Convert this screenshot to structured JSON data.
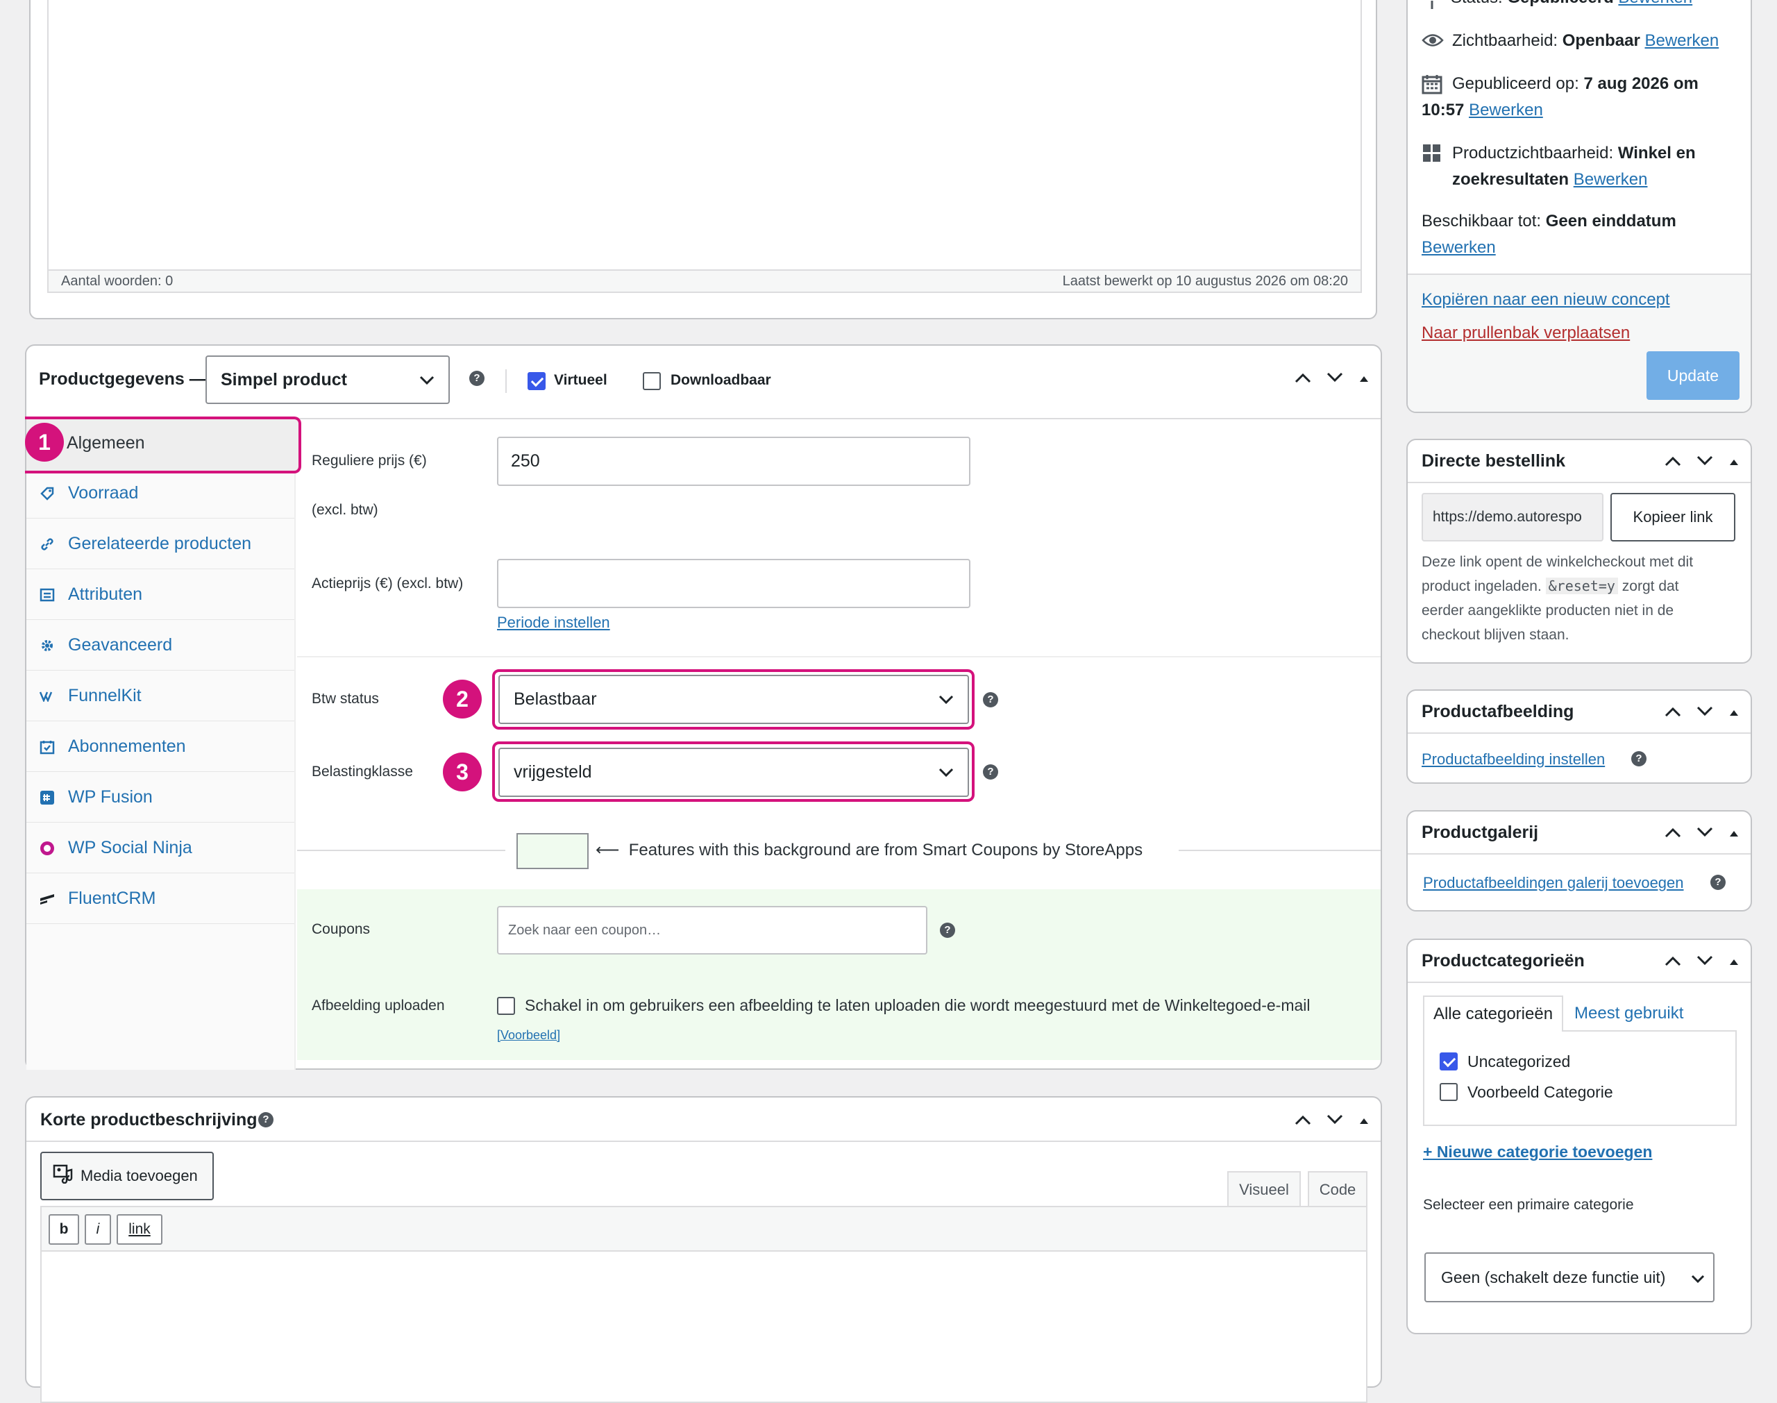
{
  "editor": {
    "word_count": "Aantal woorden: 0",
    "last_edited": "Laatst bewerkt op 10 augustus 2026 om 08:20"
  },
  "product_data": {
    "title": "Productgegevens —",
    "type_select": "Simpel product",
    "virtual_label": "Virtueel",
    "virtual_checked": true,
    "downloadable_label": "Downloadbaar",
    "downloadable_checked": false,
    "tabs": [
      {
        "label": "Algemeen",
        "icon": "wrench-icon"
      },
      {
        "label": "Voorraad",
        "icon": "tag-icon"
      },
      {
        "label": "Gerelateerde producten",
        "icon": "link-icon"
      },
      {
        "label": "Attributen",
        "icon": "list-icon"
      },
      {
        "label": "Geavanceerd",
        "icon": "gear-icon"
      },
      {
        "label": "FunnelKit",
        "icon": "funnelkit-icon"
      },
      {
        "label": "Abonnementen",
        "icon": "calendar-check-icon"
      },
      {
        "label": "WP Fusion",
        "icon": "wpfusion-icon"
      },
      {
        "label": "WP Social Ninja",
        "icon": "social-ninja-icon"
      },
      {
        "label": "FluentCRM",
        "icon": "fluentcrm-icon"
      }
    ],
    "regular_price_label": "Reguliere prijs (€)",
    "regular_price_sub": "(excl. btw)",
    "regular_price_value": "250",
    "sale_price_label": "Actieprijs (€) (excl. btw)",
    "sale_price_value": "",
    "schedule_link": "Periode instellen",
    "tax_status_label": "Btw status",
    "tax_status_value": "Belastbaar",
    "tax_class_label": "Belastingklasse",
    "tax_class_value": "vrijgesteld",
    "smart_coupons_note": "⟵  Features with this background are from Smart Coupons by StoreApps",
    "coupons_label": "Coupons",
    "coupons_placeholder": "Zoek naar een coupon…",
    "upload_label": "Afbeelding uploaden",
    "upload_text": "Schakel in om gebruikers een afbeelding te laten uploaden die wordt meegestuurd met de Winkeltegoed-e-mail",
    "upload_example": "[Voorbeeld]",
    "badges": [
      "1",
      "2",
      "3"
    ],
    "highlight_color": "#d4127c"
  },
  "short_desc": {
    "title": "Korte productbeschrijving",
    "media_button": "Media toevoegen",
    "tab_visual": "Visueel",
    "tab_code": "Code",
    "qt_bold": "b",
    "qt_italic": "i",
    "qt_link": "link"
  },
  "publish": {
    "status_label": "Status: ",
    "status_value": "Gepubliceerd",
    "status_edit": "Bewerken",
    "visibility_label": "Zichtbaarheid: ",
    "visibility_value": "Openbaar",
    "visibility_edit": "Bewerken",
    "published_label": "Gepubliceerd op: ",
    "published_value_1": "7 aug 2026 om",
    "published_value_2": "10:57",
    "published_edit": "Bewerken",
    "catalog_label": "Productzichtbaarheid: ",
    "catalog_value_1": "Winkel en",
    "catalog_value_2": "zoekresultaten",
    "catalog_edit": "Bewerken",
    "available_label": "Beschikbaar tot: ",
    "available_value": "Geen einddatum",
    "available_edit": "Bewerken",
    "copy_link": "Kopiëren naar een nieuw concept",
    "trash_link": "Naar prullenbak verplaatsen",
    "update_button": "Update"
  },
  "direct_link": {
    "title": "Directe bestellink",
    "url_value": "https://demo.autorespo",
    "copy_button": "Kopieer link",
    "desc_1": "Deze link opent de winkelcheckout met dit",
    "desc_2a": "product ingeladen. ",
    "desc_code": "&reset=y",
    "desc_2b": " zorgt dat",
    "desc_3": "eerder aangeklikte producten niet in de",
    "desc_4": "checkout blijven staan."
  },
  "product_image": {
    "title": "Productafbeelding",
    "set_link": "Productafbeelding instellen"
  },
  "gallery": {
    "title": "Productgalerij",
    "add_link": "Productafbeeldingen galerij toevoegen"
  },
  "categories": {
    "title": "Productcategorieën",
    "tab_all": "Alle categorieën",
    "tab_popular": "Meest gebruikt",
    "items": [
      {
        "label": "Uncategorized",
        "checked": true
      },
      {
        "label": "Voorbeeld Categorie",
        "checked": false
      }
    ],
    "add_link": "+ Nieuwe categorie toevoegen",
    "primary_label": "Selecteer een primaire categorie",
    "primary_value": "Geen (schakelt deze functie uit)"
  }
}
